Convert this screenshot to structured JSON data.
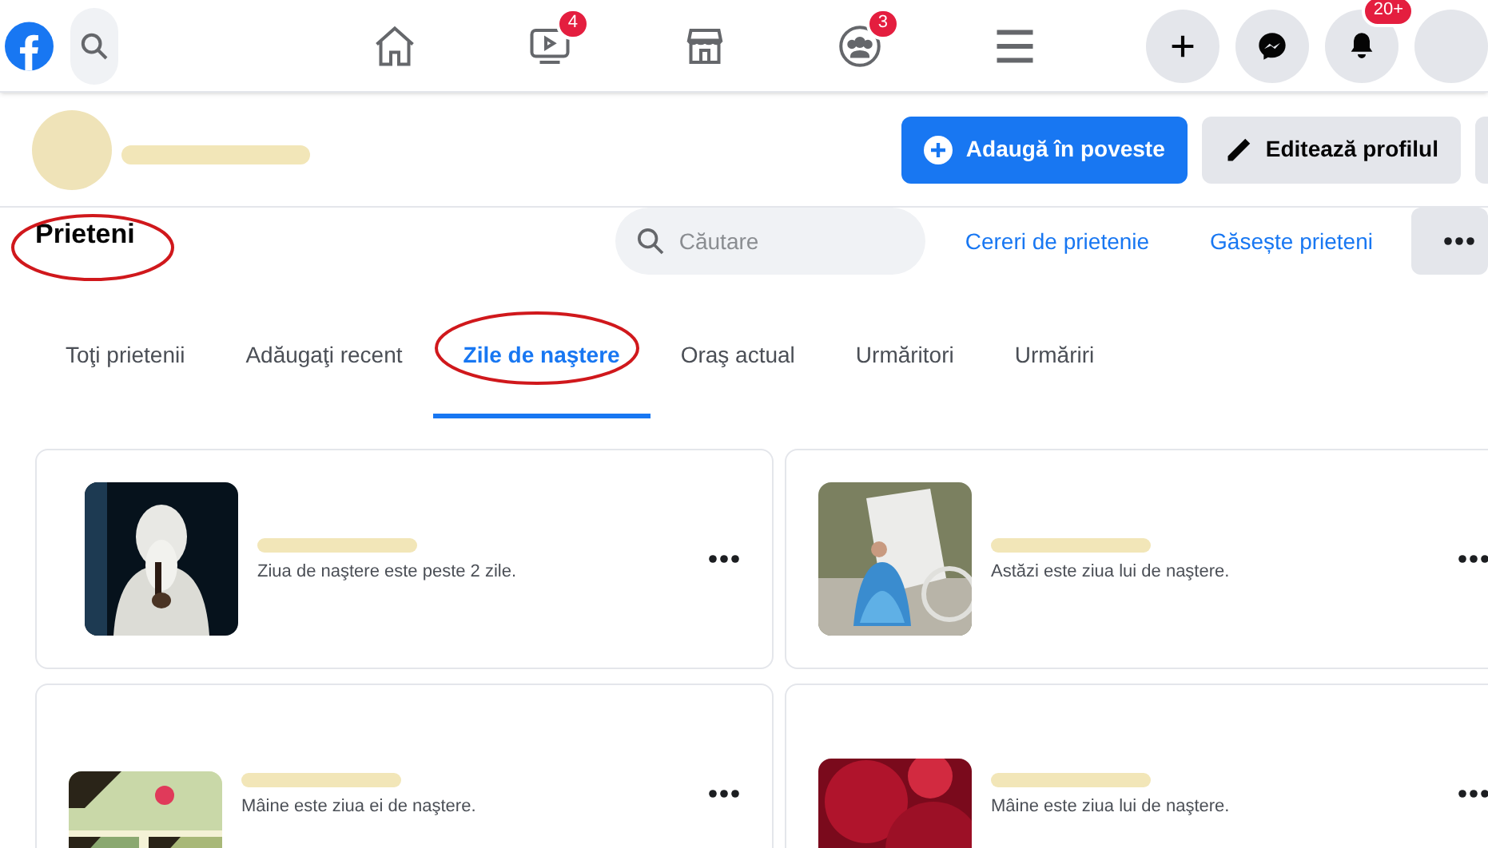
{
  "topbar": {
    "nav": [
      {
        "kind": "home",
        "selected": false
      },
      {
        "kind": "video",
        "selected": false,
        "badge": "4"
      },
      {
        "kind": "store",
        "selected": false
      },
      {
        "kind": "groups",
        "selected": false,
        "badge": "3"
      },
      {
        "kind": "menu",
        "selected": false
      }
    ],
    "actions": [
      {
        "kind": "plus"
      },
      {
        "kind": "messenger"
      },
      {
        "kind": "bell",
        "badge": "20+"
      },
      {
        "kind": "blank"
      }
    ]
  },
  "profile": {
    "buttons": [
      {
        "label": "Adaugă în poveste",
        "kind": "primary"
      },
      {
        "label": "Editează profilul",
        "kind": "secondary"
      },
      {
        "kind": "cut"
      }
    ]
  },
  "friends": {
    "title": "Prieteni",
    "title_circled": true,
    "search": {
      "placeholder": "Căutare"
    },
    "links": [
      "Cereri de prietenie",
      "Găsește prieteni"
    ],
    "tabs": [
      {
        "label": "Toţi prietenii",
        "selected": false,
        "circled": false
      },
      {
        "label": "Adăugaţi recent",
        "selected": false,
        "circled": false
      },
      {
        "label": "Zile de naştere",
        "selected": true,
        "circled": true
      },
      {
        "label": "Oraş actual",
        "selected": false,
        "circled": false
      },
      {
        "label": "Urmăritori",
        "selected": false,
        "circled": false
      },
      {
        "label": "Urmăriri",
        "selected": false,
        "circled": false
      }
    ],
    "cards": [
      {
        "note": "Ziua de naştere este peste 2 zile."
      },
      {
        "note": "Astăzi este ziua lui de naştere."
      },
      {
        "note": "Mâine este ziua ei de naştere."
      },
      {
        "note": "Mâine este ziua lui de naştere."
      }
    ]
  }
}
